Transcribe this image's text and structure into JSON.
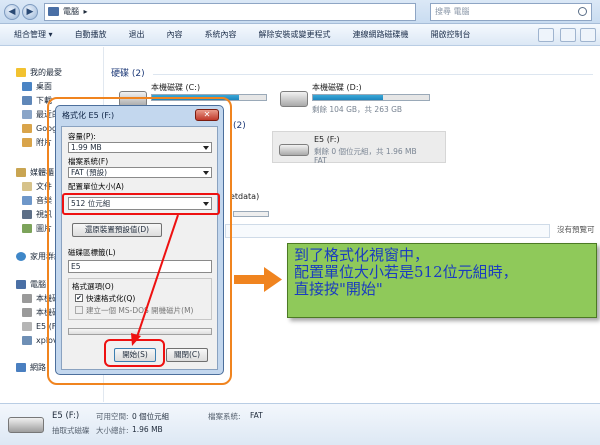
{
  "window": {
    "breadcrumb": "電腦",
    "search_placeholder": "搜尋 電腦",
    "nav_back": "◀",
    "nav_forward": "▶"
  },
  "toolbar": {
    "items": [
      "組合管理 ▾",
      "自動播放",
      "退出",
      "內容",
      "系統內容",
      "解除安裝或變更程式",
      "連線網路磁碟機",
      "開啟控制台"
    ]
  },
  "navpane": {
    "favorites": "我的最愛",
    "fav_items": [
      "桌面",
      "下載",
      "最近的",
      "Goog",
      "附片"
    ],
    "libraries": "媒體櫃",
    "lib_items": [
      "文件",
      "音樂",
      "視訊",
      "圖片"
    ],
    "homegroup": "家用群組",
    "computer": "電腦",
    "computer_items": [
      "本機磁",
      "本機磁",
      "E5 (F:)",
      "xplov"
    ],
    "network": "網路"
  },
  "content": {
    "hdd_group": "硬碟 (2)",
    "removable_group_suffix": "(2)",
    "drive_c": {
      "name": "本機磁碟 (C:)",
      "used_fraction": 0.76
    },
    "drive_d": {
      "name": "本機磁碟 (D:)",
      "free": "剩餘 104 GB，共 263 GB",
      "used_fraction": 0.6
    },
    "drive_f": {
      "name": "E5 (F:)",
      "free": "剩餘 0 個位元組，共 1.96 MB",
      "fs": "FAT"
    },
    "other_fragment": "etdata)",
    "side_note": "沒有預覽可"
  },
  "statuspane": {
    "drive_name": "E5 (F:)",
    "drive_type": "抽取式磁碟",
    "free_label": "可用空間:",
    "free_value": "0 個位元組",
    "total_label": "大小總計:",
    "total_value": "1.96 MB",
    "fs_label": "檔案系統:",
    "fs_value": "FAT"
  },
  "dialog": {
    "title": "格式化 E5 (F:)",
    "close": "✕",
    "capacity_label": "容量(P):",
    "capacity_value": "1.99 MB",
    "fs_label": "檔案系統(F)",
    "fs_value": "FAT (預設)",
    "alloc_label": "配置單位大小(A)",
    "alloc_value": "512 位元組",
    "restore_button": "還原裝置預設值(D)",
    "volume_label": "磁碟區標籤(L)",
    "volume_value": "E5",
    "options_label": "格式選項(O)",
    "quick_format": "快速格式化(Q)",
    "msdos_disk": "建立一個 MS-DOS 開機磁片(M)",
    "start_button": "開始(S)",
    "close_button": "關閉(C)",
    "progress_fraction": 0
  },
  "callout": {
    "line1": "到了格式化視窗中，",
    "line2": "配置單位大小若是512位元組時，",
    "line3": "直接按\"開始\"",
    "color_text": "#1a3cc0",
    "color_bg": "#8fc95a"
  }
}
